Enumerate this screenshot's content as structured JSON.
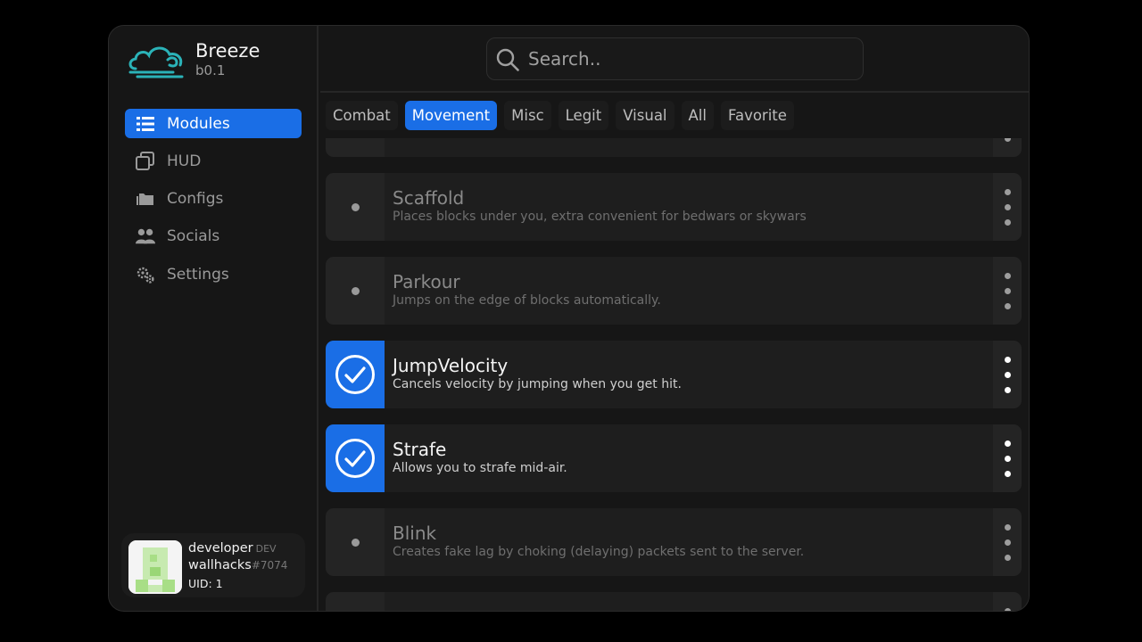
{
  "brand": {
    "name": "Breeze",
    "version": "b0.1"
  },
  "sidebar": {
    "items": [
      {
        "label": "Modules",
        "icon": "list-icon",
        "active": true
      },
      {
        "label": "HUD",
        "icon": "copy-icon",
        "active": false
      },
      {
        "label": "Configs",
        "icon": "folder-icon",
        "active": false
      },
      {
        "label": "Socials",
        "icon": "users-icon",
        "active": false
      },
      {
        "label": "Settings",
        "icon": "gears-icon",
        "active": false
      }
    ]
  },
  "user": {
    "name": "developer",
    "role": "DEV",
    "tag_name": "wallhacks",
    "tag_number": "#7074",
    "uid": "UID: 1"
  },
  "search": {
    "placeholder": "Search..",
    "value": ""
  },
  "tabs": [
    {
      "label": "Combat",
      "active": false
    },
    {
      "label": "Movement",
      "active": true
    },
    {
      "label": "Misc",
      "active": false
    },
    {
      "label": "Legit",
      "active": false
    },
    {
      "label": "Visual",
      "active": false
    },
    {
      "label": "All",
      "active": false
    },
    {
      "label": "Favorite",
      "active": false
    }
  ],
  "modules": [
    {
      "name": "",
      "desc": "",
      "enabled": false
    },
    {
      "name": "Scaffold",
      "desc": "Places blocks under you, extra convenient for bedwars or skywars",
      "enabled": false
    },
    {
      "name": "Parkour",
      "desc": "Jumps on the edge of blocks automatically.",
      "enabled": false
    },
    {
      "name": "JumpVelocity",
      "desc": "Cancels velocity by jumping when you get hit.",
      "enabled": true
    },
    {
      "name": "Strafe",
      "desc": "Allows you to strafe mid-air.",
      "enabled": true
    },
    {
      "name": "Blink",
      "desc": "Creates fake lag by choking (delaying) packets sent to the server.",
      "enabled": false
    },
    {
      "name": "",
      "desc": "",
      "enabled": false
    }
  ],
  "colors": {
    "accent": "#1a6ee6",
    "background": "#161616",
    "card": "#1e1e1e",
    "logo_teal": "#2bb3b8"
  }
}
